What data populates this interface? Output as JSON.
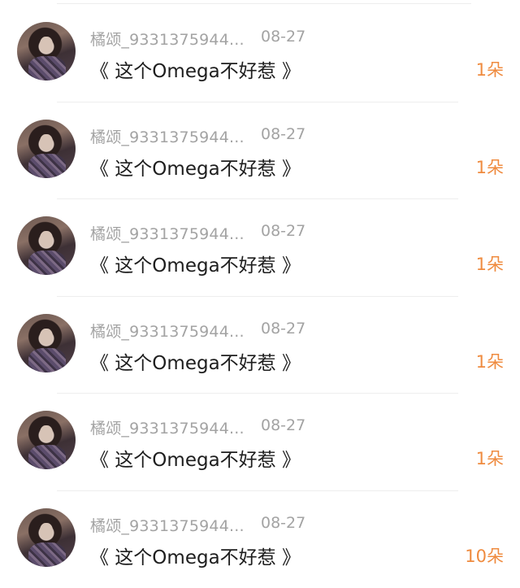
{
  "rows": [
    {
      "user": "橘颂_9331375944...",
      "date": "08-27",
      "message": "《 这个Omega不好惹 》",
      "count": "1朵"
    },
    {
      "user": "橘颂_9331375944...",
      "date": "08-27",
      "message": "《 这个Omega不好惹 》",
      "count": "1朵"
    },
    {
      "user": "橘颂_9331375944...",
      "date": "08-27",
      "message": "《 这个Omega不好惹 》",
      "count": "1朵"
    },
    {
      "user": "橘颂_9331375944...",
      "date": "08-27",
      "message": "《 这个Omega不好惹 》",
      "count": "1朵"
    },
    {
      "user": "橘颂_9331375944...",
      "date": "08-27",
      "message": "《 这个Omega不好惹 》",
      "count": "1朵"
    },
    {
      "user": "橘颂_9331375944...",
      "date": "08-27",
      "message": "《 这个Omega不好惹 》",
      "count": "10朵"
    }
  ],
  "colors": {
    "count": "#ef8b3f",
    "meta": "#a3a3a3",
    "text": "#1e1e1e"
  }
}
